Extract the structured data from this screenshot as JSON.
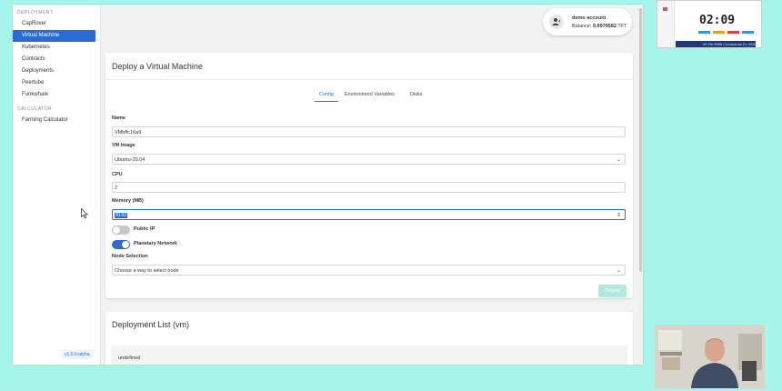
{
  "sidebar": {
    "sections": [
      {
        "heading": "DEPLOYMENT",
        "items": [
          {
            "label": "CapRover",
            "active": false
          },
          {
            "label": "Virtual Machine",
            "active": true
          },
          {
            "label": "Kubernetes",
            "active": false
          },
          {
            "label": "Contracts",
            "active": false
          },
          {
            "label": "Deployments",
            "active": false
          },
          {
            "label": "Peertube",
            "active": false
          },
          {
            "label": "Funkwhale",
            "active": false
          }
        ]
      },
      {
        "heading": "CALCULATOR",
        "items": [
          {
            "label": "Farming Calculator",
            "active": false
          }
        ]
      }
    ],
    "version": "v1.0.0-alpha"
  },
  "account": {
    "name": "demo account",
    "balance_label": "Balance: ",
    "balance_value": "9.9979582",
    "balance_unit": " TFT",
    "icon": "user-icon"
  },
  "deploy_card": {
    "title": "Deploy a Virtual Machine",
    "tabs": [
      {
        "label": "Config",
        "active": true
      },
      {
        "label": "Environment Variables",
        "active": false
      },
      {
        "label": "Disks",
        "active": false
      }
    ],
    "fields": {
      "name_label": "Name",
      "name_value": "VMbffc16a9",
      "image_label": "VM Image",
      "image_value": "Ubuntu-20.04",
      "cpu_label": "CPU",
      "cpu_value": "2",
      "memory_label": "Memory (MB)",
      "memory_value": "8192",
      "public_ip_label": "Public IP",
      "public_ip_on": false,
      "planetary_label": "Planetary Network",
      "planetary_on": true,
      "node_label": "Node Selection",
      "node_value": "Choose a way to select node"
    },
    "deploy_button": "Deploy"
  },
  "deployment_list": {
    "title": "Deployment List (vm)",
    "content": "undefined"
  },
  "timer": {
    "display": "02:09",
    "strip_text": "W~Re RMB Commands Ec XEN"
  },
  "colors": {
    "background": "#a6f5ea",
    "accent": "#2b6bd6",
    "deploy_disabled": "#b1e9e1",
    "toggle_on": "#2b6bd6",
    "toggle_off": "#c8c8c8"
  }
}
